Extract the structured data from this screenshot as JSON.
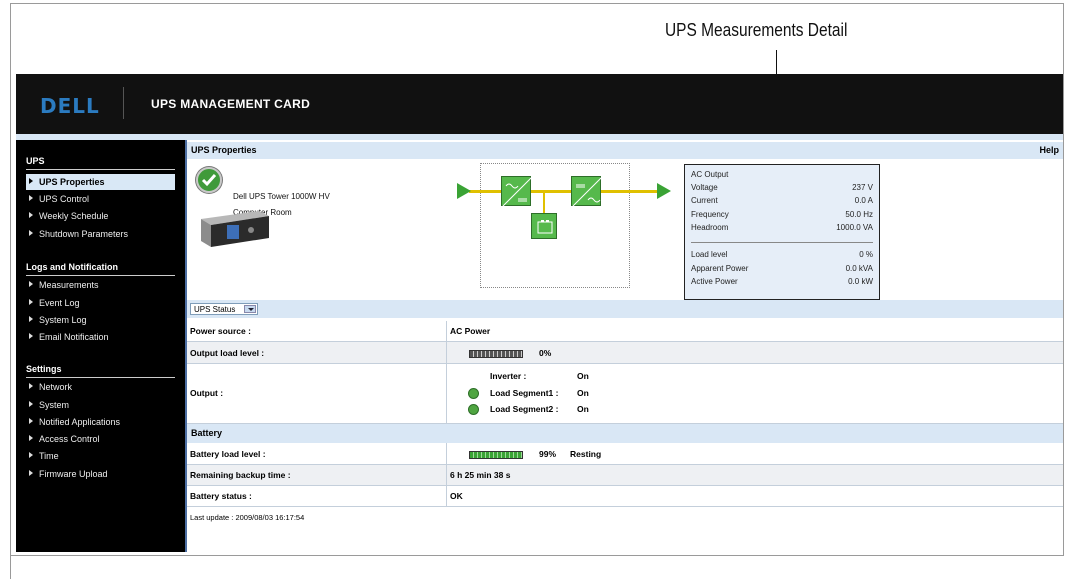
{
  "annotation": {
    "title": "UPS Measurements Detail"
  },
  "header": {
    "logo": "DELL",
    "title": "UPS MANAGEMENT CARD"
  },
  "sidebar": {
    "sections": [
      {
        "title": "UPS",
        "items": [
          "UPS Properties",
          "UPS Control",
          "Weekly Schedule",
          "Shutdown Parameters"
        ]
      },
      {
        "title": "Logs and Notification",
        "items": [
          "Measurements",
          "Event Log",
          "System Log",
          "Email Notification"
        ]
      },
      {
        "title": "Settings",
        "items": [
          "Network",
          "System",
          "Notified Applications",
          "Access Control",
          "Time",
          "Firmware Upload"
        ]
      }
    ],
    "active_item": "UPS Properties"
  },
  "panel": {
    "title": "UPS Properties",
    "help": "Help"
  },
  "product": {
    "name": "Dell UPS Tower 1000W HV",
    "location": "Computer Room"
  },
  "measurements": {
    "heading": "AC Output",
    "output_rows": [
      {
        "label": "Voltage",
        "value": "237 V"
      },
      {
        "label": "Current",
        "value": "0.0 A"
      },
      {
        "label": "Frequency",
        "value": "50.0 Hz"
      },
      {
        "label": "Headroom",
        "value": "1000.0 VA"
      }
    ],
    "load_rows": [
      {
        "label": "Load level",
        "value": "0 %"
      },
      {
        "label": "Apparent Power",
        "value": "0.0 kVA"
      },
      {
        "label": "Active Power",
        "value": "0.0 kW"
      }
    ]
  },
  "status_select": {
    "selected": "UPS Status"
  },
  "status_table": {
    "power_source": {
      "label": "Power source :",
      "value": "AC Power"
    },
    "output_load": {
      "label": "Output load level :",
      "value": "0%",
      "level": 0
    },
    "output": {
      "label": "Output :",
      "inverter_label": "Inverter :",
      "inverter_value": "On",
      "seg1_label": "Load Segment1 :",
      "seg1_value": "On",
      "seg2_label": "Load Segment2 :",
      "seg2_value": "On"
    },
    "battery_section": "Battery",
    "battery_load": {
      "label": "Battery load level :",
      "value": "99%",
      "state": "Resting",
      "level": 99
    },
    "backup_time": {
      "label": "Remaining backup time :",
      "value": "6 h 25 min 38 s"
    },
    "battery_status": {
      "label": "Battery status :",
      "value": "OK"
    }
  },
  "last_update": "Last update : 2009/08/03 16:17:54",
  "colors": {
    "header_bg": "#111111",
    "accent_blue": "#d9e7f5",
    "ok_green": "#3aa335",
    "wire_yellow": "#e0c000"
  },
  "icons": [
    "check-icon",
    "ups-device-image",
    "power-flow-diagram",
    "dropdown-arrow-icon",
    "segment-status-icon"
  ]
}
